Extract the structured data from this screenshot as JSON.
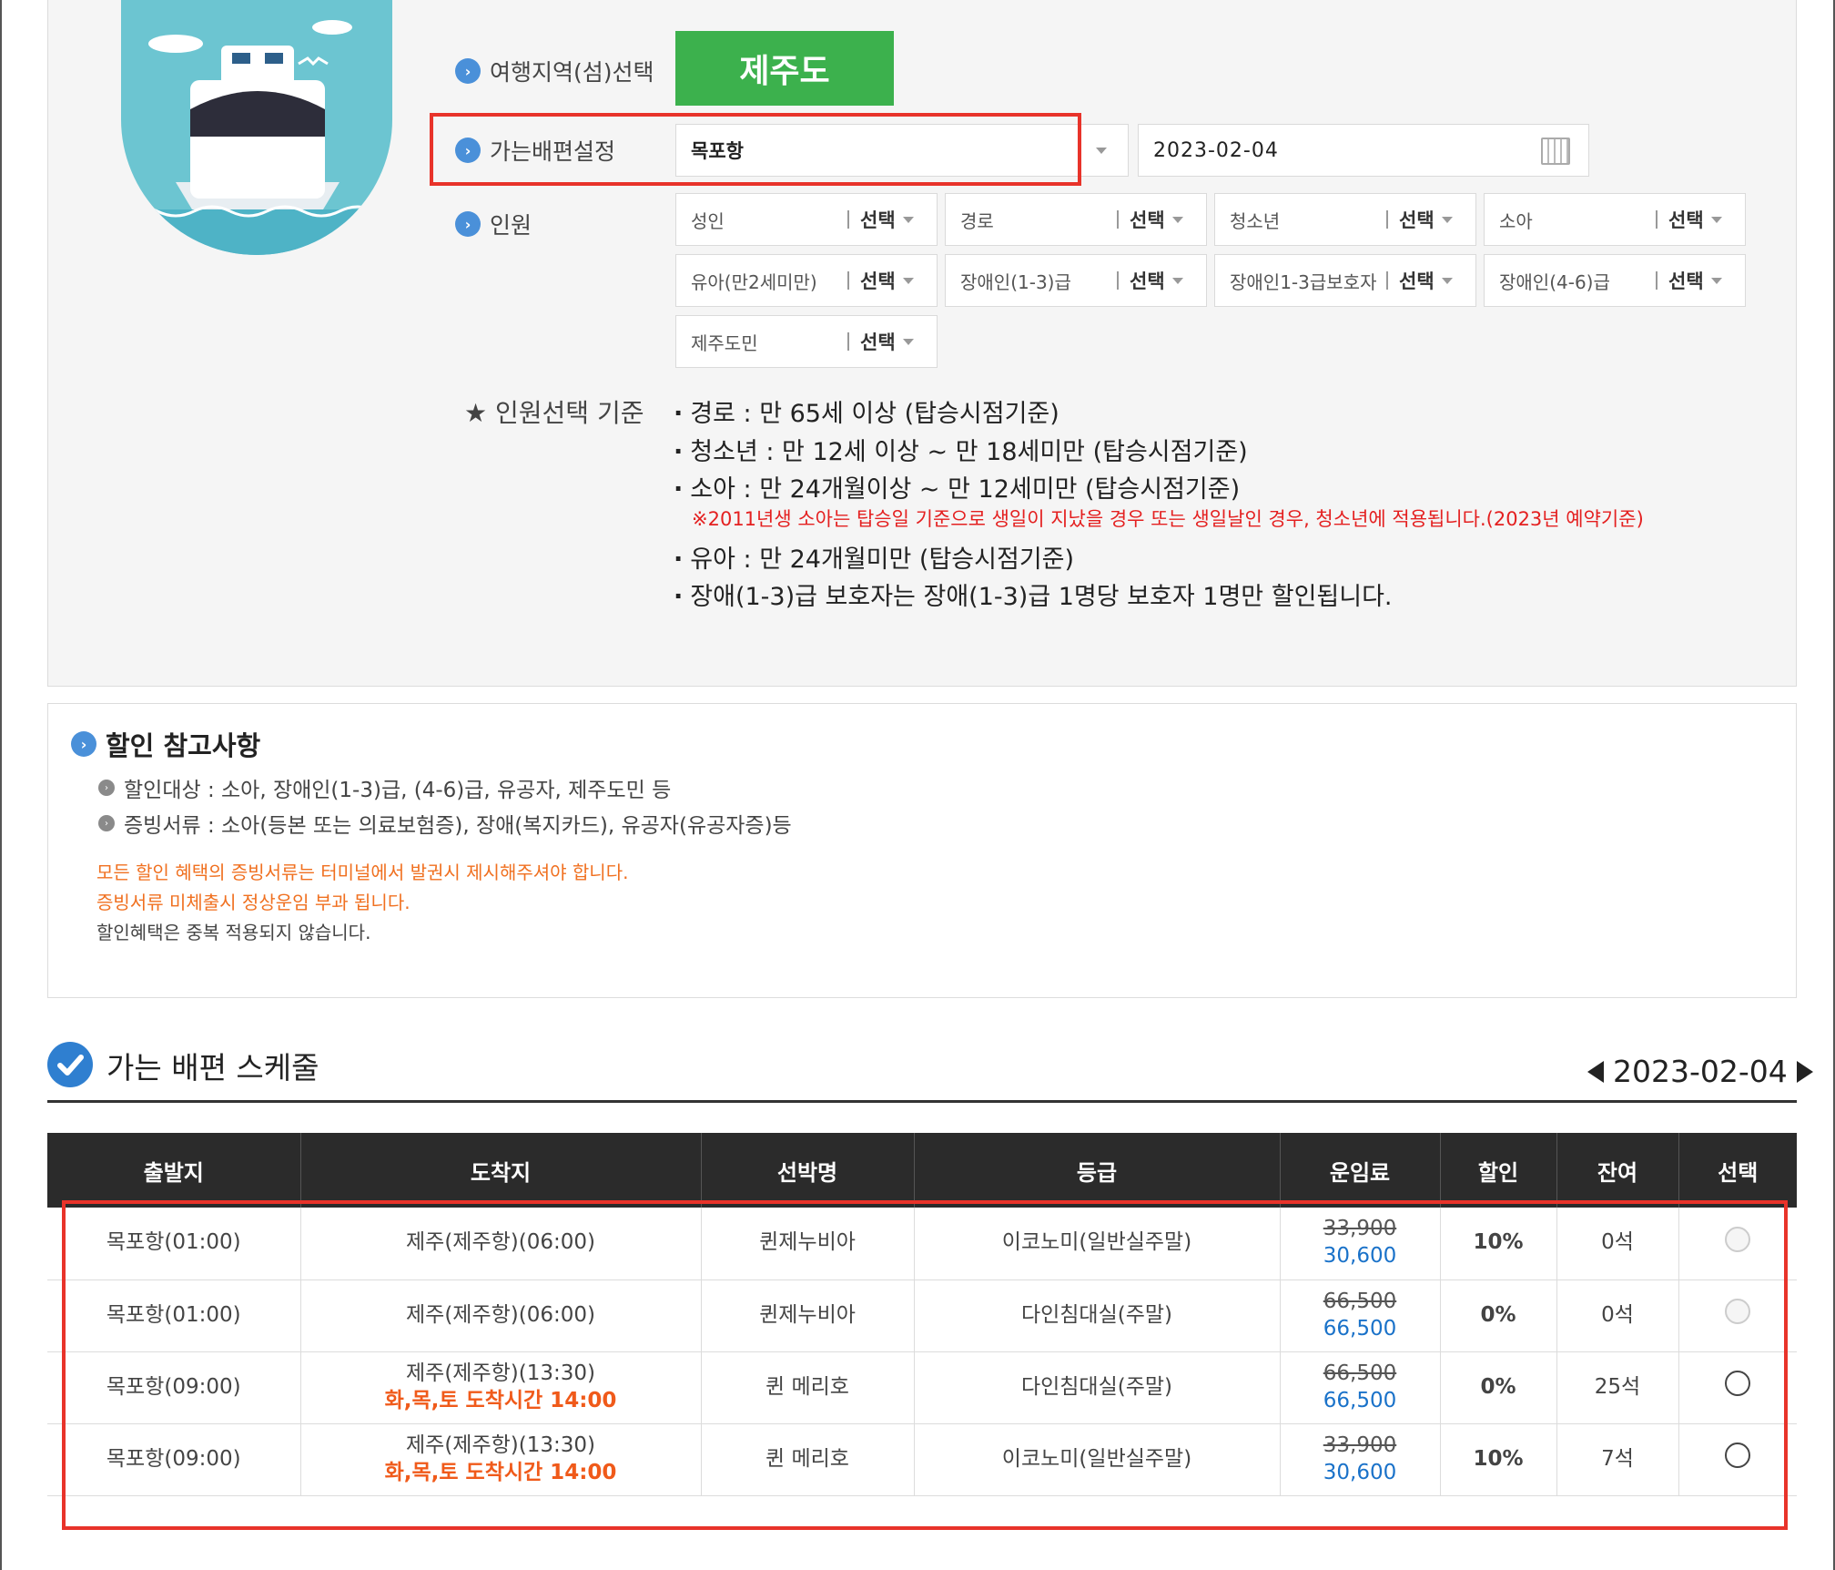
{
  "form": {
    "region_label": "여행지역(섬)선택",
    "region_value": "제주도",
    "route_label": "가는배편설정",
    "route_value": "목포항",
    "date_value": "2023-02-04",
    "people_label": "인원",
    "people": [
      {
        "name": "성인",
        "value": "선택"
      },
      {
        "name": "경로",
        "value": "선택"
      },
      {
        "name": "청소년",
        "value": "선택"
      },
      {
        "name": "소아",
        "value": "선택"
      },
      {
        "name": "유아(만2세미만)",
        "value": "선택"
      },
      {
        "name": "장애인(1-3)급",
        "value": "선택"
      },
      {
        "name": "장애인1-3급보호자",
        "value": "선택"
      },
      {
        "name": "장애인(4-6)급",
        "value": "선택"
      },
      {
        "name": "제주도민",
        "value": "선택"
      }
    ]
  },
  "criteria": {
    "label": "★ 인원선택 기준",
    "items": [
      "경로 : 만 65세 이상 (탑승시점기준)",
      "청소년 : 만 12세 이상 ~ 만 18세미만 (탑승시점기준)",
      "소아 : 만 24개월이상 ~ 만 12세미만 (탑승시점기준)",
      "유아 : 만 24개월미만 (탑승시점기준)",
      "장애(1-3)급 보호자는 장애(1-3)급 1명당 보호자 1명만 할인됩니다."
    ],
    "note": "※2011년생 소아는 탑승일 기준으로 생일이 지났을 경우 또는 생일날인 경우, 청소년에 적용됩니다.(2023년 예약기준)"
  },
  "discount": {
    "title": "할인 참고사항",
    "items": [
      "할인대상 : 소아, 장애인(1-3)급, (4-6)급, 유공자, 제주도민 등",
      "증빙서류 : 소아(등본 또는 의료보험증), 장애(복지카드), 유공자(유공자증)등"
    ],
    "warn1": "모든 할인 혜택의 증빙서류는 터미널에서 발권시 제시해주셔야 합니다.",
    "warn2": "증빙서류 미체출시 정상운임 부과 됩니다.",
    "note": "할인혜택은 중복 적용되지 않습니다."
  },
  "schedule": {
    "title": "가는 배편 스케줄",
    "date": "2023-02-04",
    "headers": [
      "출발지",
      "도착지",
      "선박명",
      "등급",
      "운임료",
      "할인",
      "잔여",
      "선택"
    ],
    "rows": [
      {
        "from": "목포항(01:00)",
        "to": "제주(제주항)(06:00)",
        "note": "",
        "ship": "퀸제누비아",
        "grade": "이코노미(일반실주말)",
        "orig": "33,900",
        "price": "30,600",
        "disc": "10%",
        "seats": "0석",
        "enabled": false
      },
      {
        "from": "목포항(01:00)",
        "to": "제주(제주항)(06:00)",
        "note": "",
        "ship": "퀸제누비아",
        "grade": "다인침대실(주말)",
        "orig": "66,500",
        "price": "66,500",
        "disc": "0%",
        "seats": "0석",
        "enabled": false
      },
      {
        "from": "목포항(09:00)",
        "to": "제주(제주항)(13:30)",
        "note": "화,목,토 도착시간 14:00",
        "ship": "퀸 메리호",
        "grade": "다인침대실(주말)",
        "orig": "66,500",
        "price": "66,500",
        "disc": "0%",
        "seats": "25석",
        "enabled": true
      },
      {
        "from": "목포항(09:00)",
        "to": "제주(제주항)(13:30)",
        "note": "화,목,토 도착시간 14:00",
        "ship": "퀸 메리호",
        "grade": "이코노미(일반실주말)",
        "orig": "33,900",
        "price": "30,600",
        "disc": "10%",
        "seats": "7석",
        "enabled": true
      }
    ]
  }
}
